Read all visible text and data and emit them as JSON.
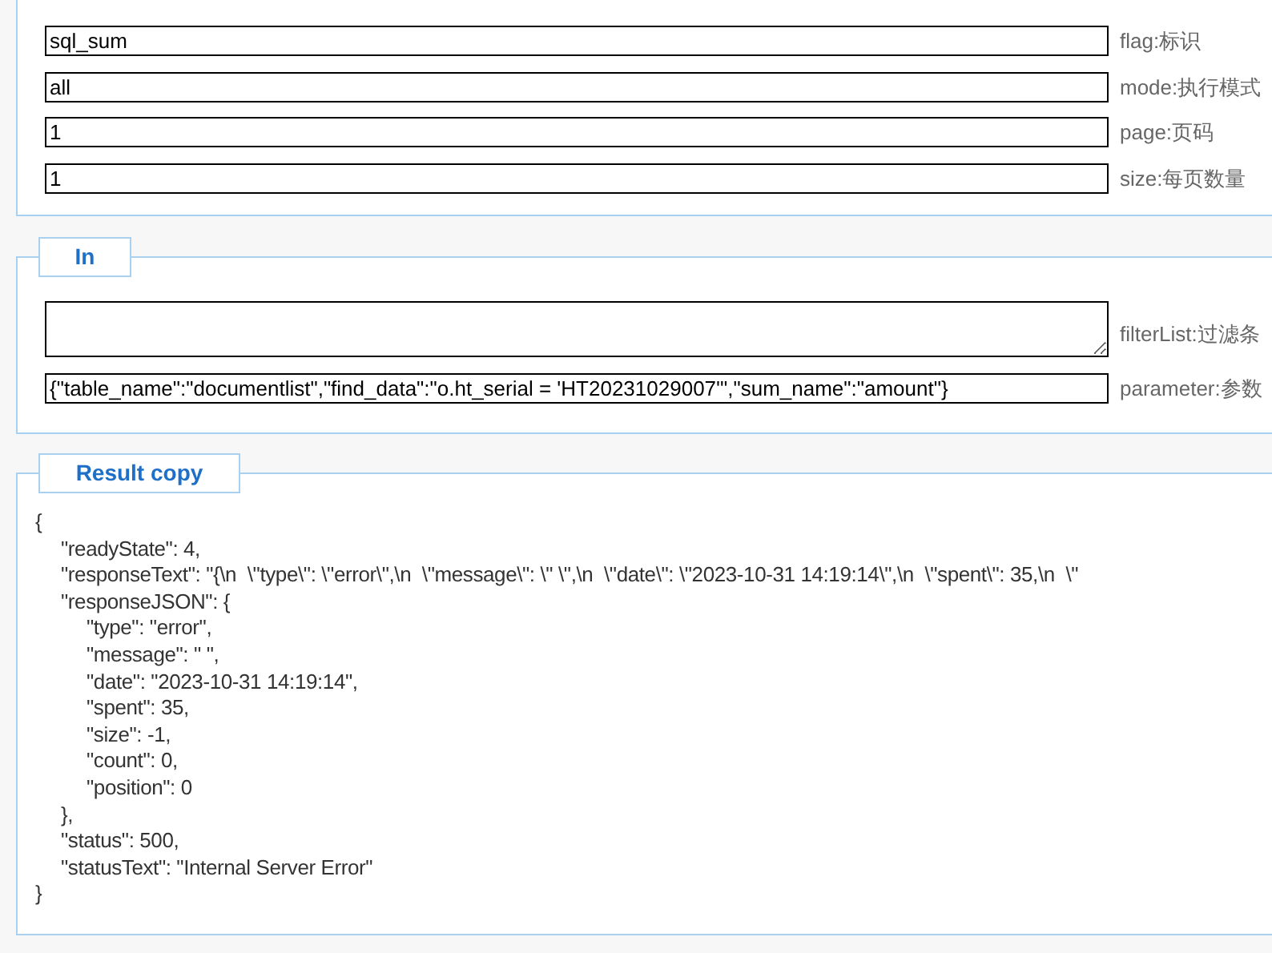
{
  "params_panel": {
    "fields": [
      {
        "value": "sql_sum",
        "label": "flag:标识"
      },
      {
        "value": "all",
        "label": "mode:执行模式"
      },
      {
        "value": "1",
        "label": "page:页码"
      },
      {
        "value": "1",
        "label": "size:每页数量"
      }
    ]
  },
  "in_panel": {
    "legend": "In",
    "fields": [
      {
        "kind": "textarea",
        "label": "filterList:过滤条"
      },
      {
        "kind": "input",
        "value": "{\"table_name\":\"documentlist\",\"find_data\":\"o.ht_serial = 'HT20231029007'\",\"sum_name\":\"amount\"}",
        "label": "parameter:参数"
      }
    ]
  },
  "result_panel": {
    "legend": "Result copy",
    "result": {
      "open": "{",
      "entries": [
        {
          "text": "\"readyState\": 4,"
        },
        {
          "text": "\"responseText\": \"{\\n  \\\"type\\\": \\\"error\\\",\\n  \\\"message\\\": \\\" \\\",\\n  \\\"date\\\": \\\"2023-10-31 14:19:14\\\",\\n  \\\"spent\\\": 35,\\n  \\\""
        },
        {
          "text": "\"responseJSON\": {",
          "children": [
            {
              "text": "\"type\": \"error\","
            },
            {
              "text": "\"message\": \" \","
            },
            {
              "text": "\"date\": \"2023-10-31 14:19:14\","
            },
            {
              "text": "\"spent\": 35,"
            },
            {
              "text": "\"size\": -1,"
            },
            {
              "text": "\"count\": 0,"
            },
            {
              "text": "\"position\": 0"
            }
          ],
          "close": "},"
        },
        {
          "text": "\"status\": 500,"
        },
        {
          "text": "\"statusText\": \"Internal Server Error\""
        }
      ],
      "close": "}"
    }
  }
}
